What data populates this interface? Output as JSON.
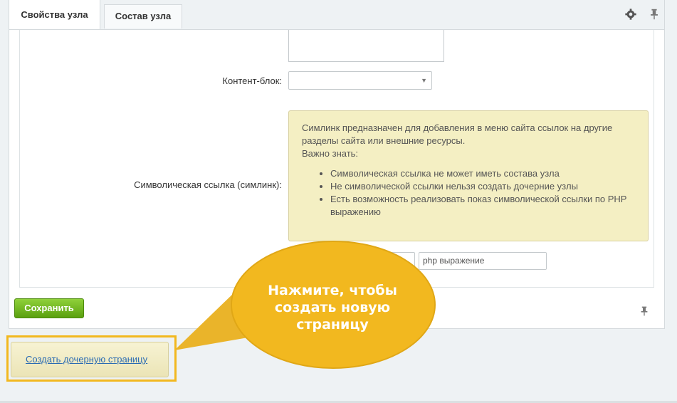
{
  "tabs": [
    {
      "label": "Свойства узла",
      "active": true
    },
    {
      "label": "Состав узла",
      "active": false
    }
  ],
  "toolbar": {
    "settings_icon": "gear-icon",
    "pin_icon": "pin-icon"
  },
  "form": {
    "content_block_label": "Контент-блок:",
    "content_block_value": "",
    "symlink_label": "Символическая ссылка (симлинк):",
    "hint": {
      "line1": "Симлинк предназначен для добавления в меню сайта ссылок на другие разделы сайта или внешние ресурсы.",
      "line2": "Важно знать:",
      "items": [
        "Символическая ссылка не может иметь состава узла",
        "Не символической ссылки нельзя создать дочерние узлы",
        "Есть возможность реализовать показ символической ссылки по PHP выражению"
      ]
    },
    "php_placeholder": "php выражение"
  },
  "save_button": "Сохранить",
  "callout": {
    "line1": "Нажмите, чтобы",
    "line2": "создать новую",
    "line3": "страницу"
  },
  "create_child_button": "Создать дочерную страницу",
  "colors": {
    "accent": "#f2b81f",
    "save": "#5aa00f",
    "hint_bg": "#f4efc3",
    "link": "#2a6bb3"
  }
}
